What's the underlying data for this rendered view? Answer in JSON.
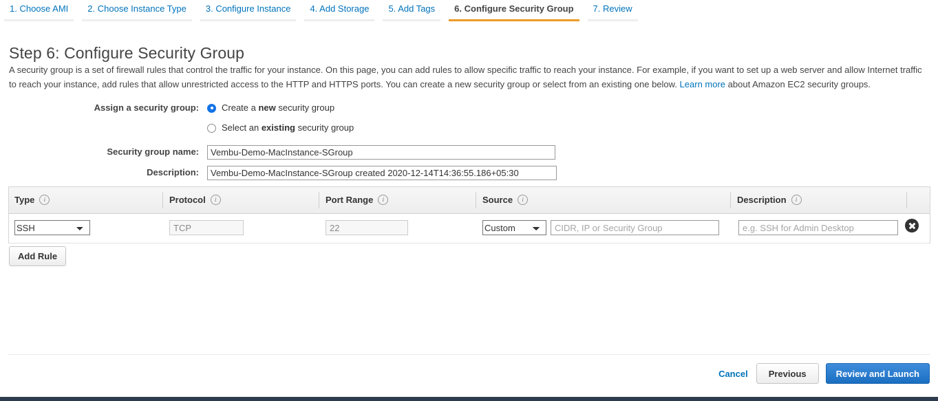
{
  "wizard": {
    "tabs": [
      {
        "label": "1. Choose AMI",
        "active": false
      },
      {
        "label": "2. Choose Instance Type",
        "active": false
      },
      {
        "label": "3. Configure Instance",
        "active": false
      },
      {
        "label": "4. Add Storage",
        "active": false
      },
      {
        "label": "5. Add Tags",
        "active": false
      },
      {
        "label": "6. Configure Security Group",
        "active": true
      },
      {
        "label": "7. Review",
        "active": false
      }
    ],
    "active_tab_color": "#ec9b26",
    "link_color": "#0073bb"
  },
  "page": {
    "title": "Step 6: Configure Security Group",
    "intro_part1": "A security group is a set of firewall rules that control the traffic for your instance. On this page, you can add rules to allow specific traffic to reach your instance. For example, if you want to set up a web server and allow Internet traffic to reach your instance, add rules that allow unrestricted access to the HTTP and HTTPS ports. You can create a new security group or select from an existing one below. ",
    "intro_link": "Learn more",
    "intro_part2": " about Amazon EC2 security groups."
  },
  "assign": {
    "label": "Assign a security group:",
    "option_new_prefix": "Create a ",
    "option_new_bold": "new",
    "option_new_suffix": " security group",
    "option_existing_prefix": "Select an ",
    "option_existing_bold": "existing",
    "option_existing_suffix": " security group",
    "selected": "new"
  },
  "fields": {
    "name_label": "Security group name:",
    "name_value": "Vembu-Demo-MacInstance-SGroup",
    "description_label": "Description:",
    "description_value": "Vembu-Demo-MacInstance-SGroup created 2020-12-14T14:36:55.186+05:30"
  },
  "rules_table": {
    "columns": [
      {
        "label": "Type",
        "info": "i"
      },
      {
        "label": "Protocol",
        "info": "i"
      },
      {
        "label": "Port Range",
        "info": "i"
      },
      {
        "label": "Source",
        "info": "i"
      },
      {
        "label": "Description",
        "info": "i"
      }
    ],
    "rows": [
      {
        "type_value": "SSH",
        "type_options": [
          "SSH"
        ],
        "protocol_value": "TCP",
        "port_range_value": "22",
        "source_value": "Custom",
        "source_options": [
          "Custom"
        ],
        "source_cidr_value": "",
        "source_cidr_placeholder": "CIDR, IP or Security Group",
        "description_value": "",
        "description_placeholder": "e.g. SSH for Admin Desktop",
        "delete_icon": "close-circle-icon"
      }
    ]
  },
  "actions": {
    "add_rule_label": "Add Rule",
    "cancel_label": "Cancel",
    "previous_label": "Previous",
    "review_launch_label": "Review and Launch"
  }
}
